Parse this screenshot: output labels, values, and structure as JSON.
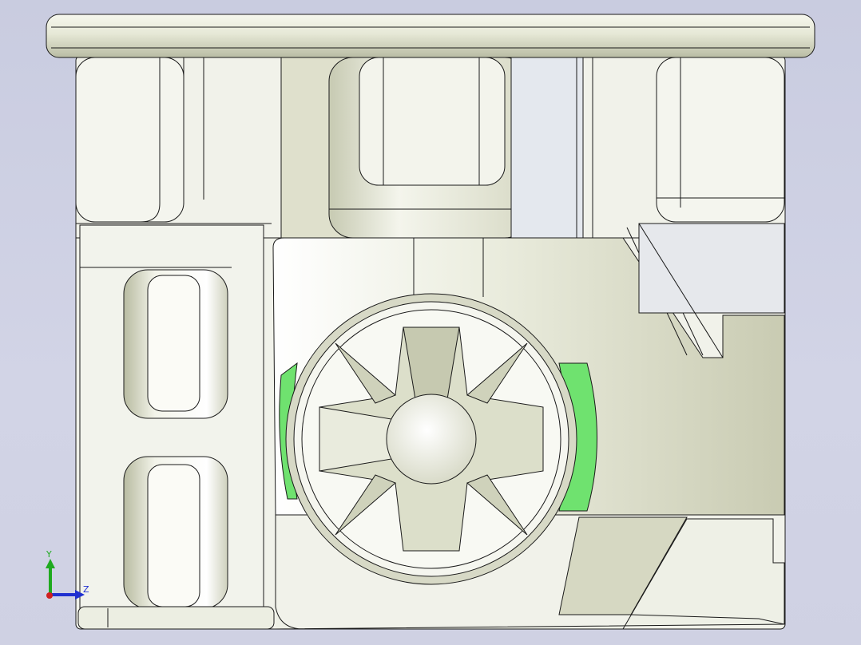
{
  "viewport": {
    "background_top": "#c9cce0",
    "background_bottom": "#cfd1e3",
    "body_color": "#eef0e8",
    "shadow_color": "#d6d8c4",
    "edge_color": "#1a1a1a",
    "highlight_color": "#6fe26f",
    "face_color_blue": "#e4e8ee"
  },
  "triad": {
    "y_label": "Y",
    "z_label": "Z",
    "y_color": "#1faa1f",
    "z_color": "#2030d0",
    "x_color": "#d02020"
  }
}
